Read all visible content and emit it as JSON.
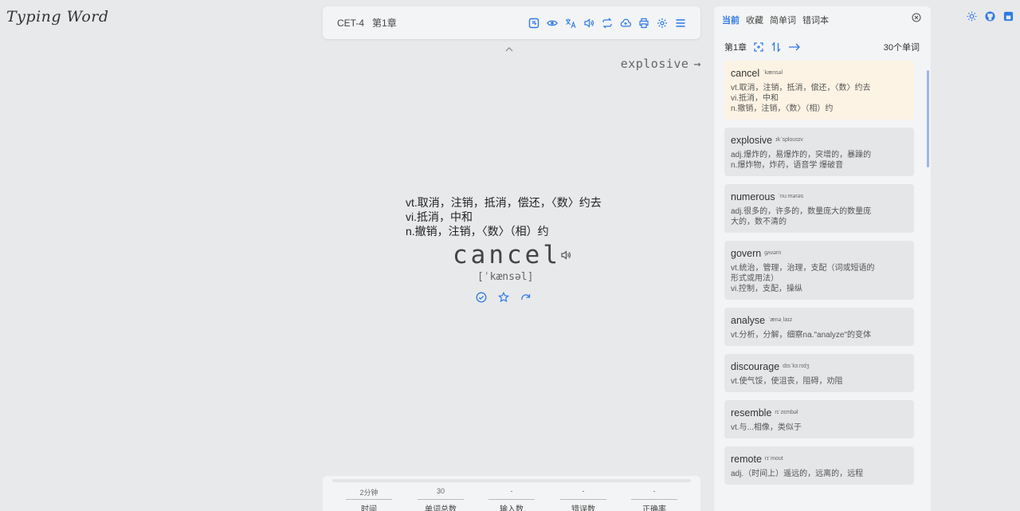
{
  "app": {
    "logo": "Typing Word"
  },
  "toolbar": {
    "dict": "CET-4",
    "chapter": "第1章",
    "icons": [
      "dict-icon",
      "eye-icon",
      "translate-icon",
      "sound-icon",
      "loop-icon",
      "cloud-upload-icon",
      "print-icon",
      "settings-icon",
      "menu-icon"
    ]
  },
  "next": {
    "word": "explosive",
    "arrow": "→"
  },
  "current": {
    "translation": [
      "vt.取消，注销，抵消，偿还，〈数〉约去",
      "vi.抵消，中和",
      "n.撤销，注销，〈数〉（相）约"
    ],
    "word": "cancel",
    "phonetic": "[ˈkænsəl]"
  },
  "stats": [
    {
      "value": "2分钟",
      "label": "时间"
    },
    {
      "value": "30",
      "label": "单词总数"
    },
    {
      "value": "-",
      "label": "输入数"
    },
    {
      "value": "-",
      "label": "错误数"
    },
    {
      "value": "-",
      "label": "正确率"
    }
  ],
  "panel": {
    "tabs": [
      "当前",
      "收藏",
      "简单词",
      "错词本"
    ],
    "chapter": "第1章",
    "count": "30个单词",
    "words": [
      {
        "word": "cancel",
        "phonetic": "ˈkænsəl",
        "trans": [
          "vt.取消，注销，抵消，偿还，〈数〉约去",
          "vi.抵消，中和",
          "n.撤销，注销，〈数〉（相）约"
        ]
      },
      {
        "word": "explosive",
        "phonetic": "ɪkˈsploʊsɪv",
        "trans": [
          "adj.爆炸的，易爆炸的，突增的，暴躁的",
          "n.爆炸物，炸药，语音学 爆破音"
        ]
      },
      {
        "word": "numerous",
        "phonetic": "ˈnuːmərəs",
        "trans": [
          "adj.很多的，许多的，数量庞大的数量庞",
          "大的，数不清的"
        ]
      },
      {
        "word": "govern",
        "phonetic": "ɡʌvərn",
        "trans": [
          "vt.统治，管理，治理，支配（词或短语的",
          "形式或用法）",
          "vi.控制，支配，操纵"
        ]
      },
      {
        "word": "analyse",
        "phonetic": "ˈænəˌlaɪz",
        "trans": [
          "vt.分析，分解，细察na.\"analyze\"的变体"
        ]
      },
      {
        "word": "discourage",
        "phonetic": "dɪsˈkɜːrɪdʒ",
        "trans": [
          "vt.使气馁，使沮丧，阻碍，劝阻"
        ]
      },
      {
        "word": "resemble",
        "phonetic": "rɪˈzɛmbəl",
        "trans": [
          "vt.与...相像，类似于"
        ]
      },
      {
        "word": "remote",
        "phonetic": "rɪˈmoʊt",
        "trans": [
          "adj.（时间上）遥远的，远离的，远程"
        ]
      }
    ]
  },
  "side_icons": [
    "sun-icon",
    "github-icon",
    "app-icon"
  ]
}
